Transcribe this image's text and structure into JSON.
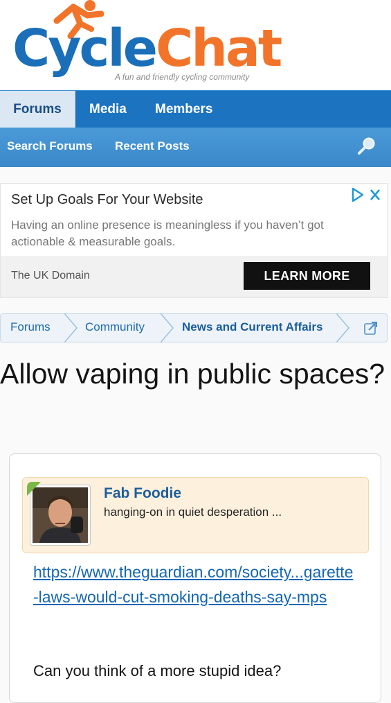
{
  "logo": {
    "word_part1": "Cycle",
    "word_part2": "Chat",
    "tagline": "A fun and friendly cycling community",
    "icon": "cyclist-icon"
  },
  "nav": {
    "tabs": [
      {
        "label": "Forums",
        "active": true
      },
      {
        "label": "Media",
        "active": false
      },
      {
        "label": "Members",
        "active": false
      }
    ],
    "subnav": [
      "Search Forums",
      "Recent Posts"
    ],
    "search_icon": "search-icon"
  },
  "ad": {
    "title": "Set Up Goals For Your Website",
    "body": "Having an online presence is meaningless if you haven’t got actionable & measurable goals.",
    "domain": "The UK Domain",
    "cta": "LEARN MORE",
    "icons": [
      "adchoices-icon",
      "close-icon"
    ]
  },
  "breadcrumb": [
    {
      "label": "Forums"
    },
    {
      "label": "Community"
    },
    {
      "label": "News and Current Affairs"
    }
  ],
  "thread": {
    "title": "Allow vaping in public spaces?"
  },
  "post": {
    "author": "Fab Foodie",
    "author_title": "hanging-on in quiet desperation ...",
    "link": "https://www.theguardian.com/society...garette-laws-would-cut-smoking-deaths-say-mps",
    "text": "Can you think of a more stupid idea?"
  },
  "colors": {
    "brand_blue": "#1c74c0",
    "brand_orange": "#f2742a",
    "author_box_bg": "#fdf0dd"
  }
}
